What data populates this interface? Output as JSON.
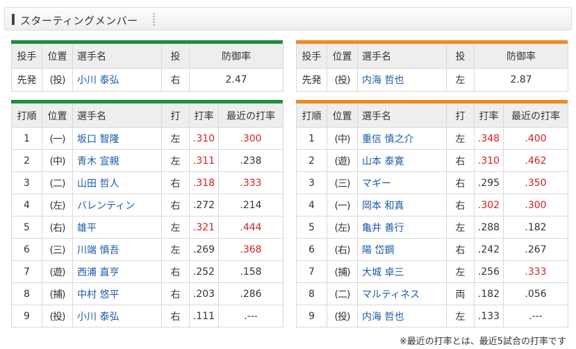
{
  "section_title": "スターティングメンバー",
  "colors": {
    "left_team": "#1f8a3d",
    "right_team": "#f08a1d",
    "high_value": "#d42020",
    "player_link": "#1a5aa8"
  },
  "pitcher_headers": [
    "投手",
    "位置",
    "選手名",
    "投",
    "防御率"
  ],
  "batter_headers": [
    "打順",
    "位置",
    "選手名",
    "打",
    "打率",
    "最近の打率"
  ],
  "left": {
    "pitcher": {
      "role": "先発",
      "pos": "(投)",
      "name": "小川 泰弘",
      "hand": "右",
      "era": "2.47"
    },
    "batters": [
      {
        "order": "1",
        "pos": "(一)",
        "name": "坂口 智隆",
        "hand": "左",
        "avg": ".310",
        "avg_hi": true,
        "recent": ".300",
        "recent_hi": true
      },
      {
        "order": "2",
        "pos": "(中)",
        "name": "青木 宣親",
        "hand": "左",
        "avg": ".311",
        "avg_hi": true,
        "recent": ".238",
        "recent_hi": false
      },
      {
        "order": "3",
        "pos": "(二)",
        "name": "山田 哲人",
        "hand": "右",
        "avg": ".318",
        "avg_hi": true,
        "recent": ".333",
        "recent_hi": true
      },
      {
        "order": "4",
        "pos": "(左)",
        "name": "バレンティン",
        "hand": "右",
        "avg": ".272",
        "avg_hi": false,
        "recent": ".214",
        "recent_hi": false
      },
      {
        "order": "5",
        "pos": "(右)",
        "name": "雄平",
        "hand": "左",
        "avg": ".321",
        "avg_hi": true,
        "recent": ".444",
        "recent_hi": true
      },
      {
        "order": "6",
        "pos": "(三)",
        "name": "川端 慎吾",
        "hand": "左",
        "avg": ".269",
        "avg_hi": false,
        "recent": ".368",
        "recent_hi": true
      },
      {
        "order": "7",
        "pos": "(遊)",
        "name": "西浦 直亨",
        "hand": "右",
        "avg": ".252",
        "avg_hi": false,
        "recent": ".158",
        "recent_hi": false
      },
      {
        "order": "8",
        "pos": "(捕)",
        "name": "中村 悠平",
        "hand": "右",
        "avg": ".203",
        "avg_hi": false,
        "recent": ".286",
        "recent_hi": false
      },
      {
        "order": "9",
        "pos": "(投)",
        "name": "小川 泰弘",
        "hand": "右",
        "avg": ".111",
        "avg_hi": false,
        "recent": ".---",
        "recent_hi": false
      }
    ]
  },
  "right": {
    "pitcher": {
      "role": "先発",
      "pos": "(投)",
      "name": "内海 哲也",
      "hand": "左",
      "era": "2.87"
    },
    "batters": [
      {
        "order": "1",
        "pos": "(中)",
        "name": "重信 慎之介",
        "hand": "左",
        "avg": ".348",
        "avg_hi": true,
        "recent": ".400",
        "recent_hi": true
      },
      {
        "order": "2",
        "pos": "(遊)",
        "name": "山本 泰寛",
        "hand": "右",
        "avg": ".310",
        "avg_hi": true,
        "recent": ".462",
        "recent_hi": true
      },
      {
        "order": "3",
        "pos": "(三)",
        "name": "マギー",
        "hand": "右",
        "avg": ".295",
        "avg_hi": false,
        "recent": ".350",
        "recent_hi": true
      },
      {
        "order": "4",
        "pos": "(一)",
        "name": "岡本 和真",
        "hand": "右",
        "avg": ".302",
        "avg_hi": true,
        "recent": ".300",
        "recent_hi": true
      },
      {
        "order": "5",
        "pos": "(左)",
        "name": "亀井 善行",
        "hand": "左",
        "avg": ".288",
        "avg_hi": false,
        "recent": ".182",
        "recent_hi": false
      },
      {
        "order": "6",
        "pos": "(右)",
        "name": "陽 岱鋼",
        "hand": "右",
        "avg": ".242",
        "avg_hi": false,
        "recent": ".267",
        "recent_hi": false
      },
      {
        "order": "7",
        "pos": "(捕)",
        "name": "大城 卓三",
        "hand": "左",
        "avg": ".256",
        "avg_hi": false,
        "recent": ".333",
        "recent_hi": true
      },
      {
        "order": "8",
        "pos": "(二)",
        "name": "マルティネス",
        "hand": "両",
        "avg": ".182",
        "avg_hi": false,
        "recent": ".056",
        "recent_hi": false
      },
      {
        "order": "9",
        "pos": "(投)",
        "name": "内海 哲也",
        "hand": "左",
        "avg": ".133",
        "avg_hi": false,
        "recent": ".---",
        "recent_hi": false
      }
    ]
  },
  "footnote": "※最近の打率とは、最近5試合の打率です"
}
